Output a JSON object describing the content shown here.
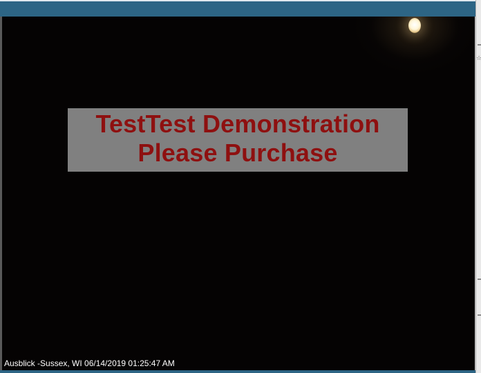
{
  "window": {
    "title_bar_color": "#2d6585",
    "frame_background": "#050303"
  },
  "banner": {
    "line1": "TestTest Demonstration",
    "line2": "Please Purchase",
    "text_color": "#8e1010",
    "background": "#808080"
  },
  "caption": {
    "text": "Ausblick -Sussex, WI 06/14/2019 01:25:47 AM",
    "color": "#ffffff"
  },
  "icons": {
    "moon": "moon-icon",
    "edge_star": "star-icon"
  }
}
